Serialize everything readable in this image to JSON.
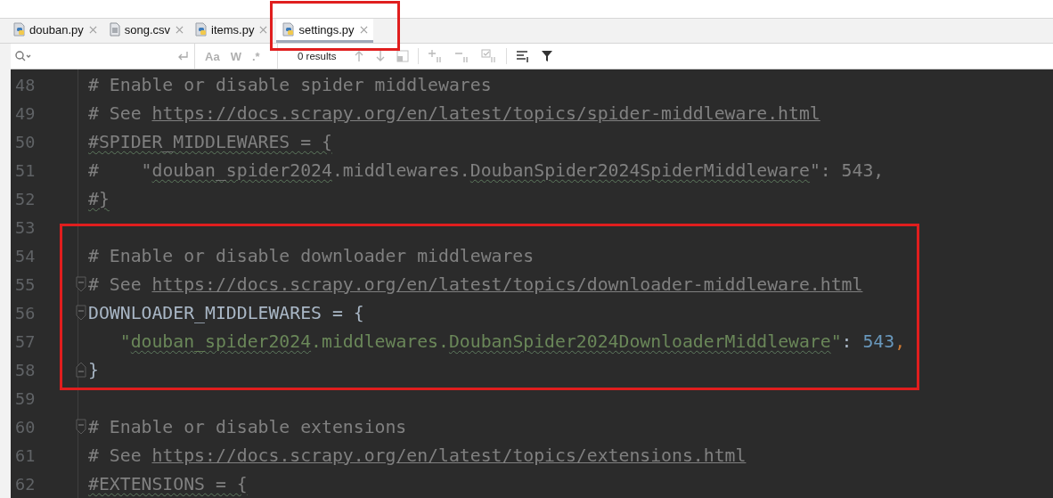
{
  "tabs": [
    {
      "label": "douban.py",
      "kind": "python",
      "selected": false
    },
    {
      "label": "song.csv",
      "kind": "text",
      "selected": false
    },
    {
      "label": "items.py",
      "kind": "python",
      "selected": false
    },
    {
      "label": "settings.py",
      "kind": "python",
      "selected": true
    }
  ],
  "find_bar": {
    "match_case": "Aa",
    "words": "W",
    "regex": ".*",
    "results": "0 results"
  },
  "lines": [
    {
      "number": "48",
      "tokens": [
        {
          "t": "# Enable or disable spider middlewares",
          "kind": "comment"
        }
      ]
    },
    {
      "number": "49",
      "tokens": [
        {
          "t": "# See ",
          "kind": "comment"
        },
        {
          "t": "https://docs.scrapy.org/en/latest/topics/spider-middleware.html",
          "kind": "link"
        }
      ]
    },
    {
      "number": "50",
      "tokens": [
        {
          "t": "#SPIDER_MIDDLEWARES = {",
          "kind": "comment",
          "typo": true
        }
      ]
    },
    {
      "number": "51",
      "tokens": [
        {
          "t": "#    \"",
          "kind": "comment"
        },
        {
          "t": "douban_spider2024",
          "kind": "comment",
          "typo": true
        },
        {
          "t": ".middlewares.",
          "kind": "comment"
        },
        {
          "t": "DoubanSpider2024SpiderMiddleware",
          "kind": "comment",
          "typo": true
        },
        {
          "t": "\": 543,",
          "kind": "comment"
        }
      ]
    },
    {
      "number": "52",
      "tokens": [
        {
          "t": "#}",
          "kind": "comment",
          "typo": true
        }
      ]
    },
    {
      "number": "53"
    },
    {
      "number": "54",
      "tokens": [
        {
          "t": "# Enable or disable downloader middlewares",
          "kind": "comment"
        }
      ]
    },
    {
      "number": "55",
      "fold_start": true,
      "tokens": [
        {
          "t": "# See ",
          "kind": "comment"
        },
        {
          "t": "https://docs.scrapy.org/en/latest/topics/downloader-middleware.html",
          "kind": "link"
        }
      ]
    },
    {
      "number": "56",
      "fold_start": true,
      "tokens": [
        {
          "t": "DOWNLOADER_MIDDLEWARES = {",
          "kind": "plain"
        }
      ]
    },
    {
      "number": "57",
      "tokens": [
        {
          "t": "   \"",
          "kind": "string"
        },
        {
          "t": "douban_spider2024",
          "kind": "string",
          "typo": true
        },
        {
          "t": ".middlewares.",
          "kind": "string"
        },
        {
          "t": "DoubanSpider2024DownloaderMiddleware",
          "kind": "string",
          "typo": true
        },
        {
          "t": "\"",
          "kind": "string"
        },
        {
          "t": ": ",
          "kind": "plain"
        },
        {
          "t": "543",
          "kind": "number"
        },
        {
          "t": ",",
          "kind": "punct"
        }
      ]
    },
    {
      "number": "58",
      "fold_end": true,
      "tokens": [
        {
          "t": "}",
          "kind": "plain"
        }
      ]
    },
    {
      "number": "59"
    },
    {
      "number": "60",
      "fold_start": true,
      "tokens": [
        {
          "t": "# Enable or disable extensions",
          "kind": "comment"
        }
      ]
    },
    {
      "number": "61",
      "tokens": [
        {
          "t": "# See ",
          "kind": "comment"
        },
        {
          "t": "https://docs.scrapy.org/en/latest/topics/extensions.html",
          "kind": "link"
        }
      ]
    },
    {
      "number": "62",
      "tokens": [
        {
          "t": "#EXTENSIONS = {",
          "kind": "comment",
          "typo": true
        }
      ]
    }
  ]
}
